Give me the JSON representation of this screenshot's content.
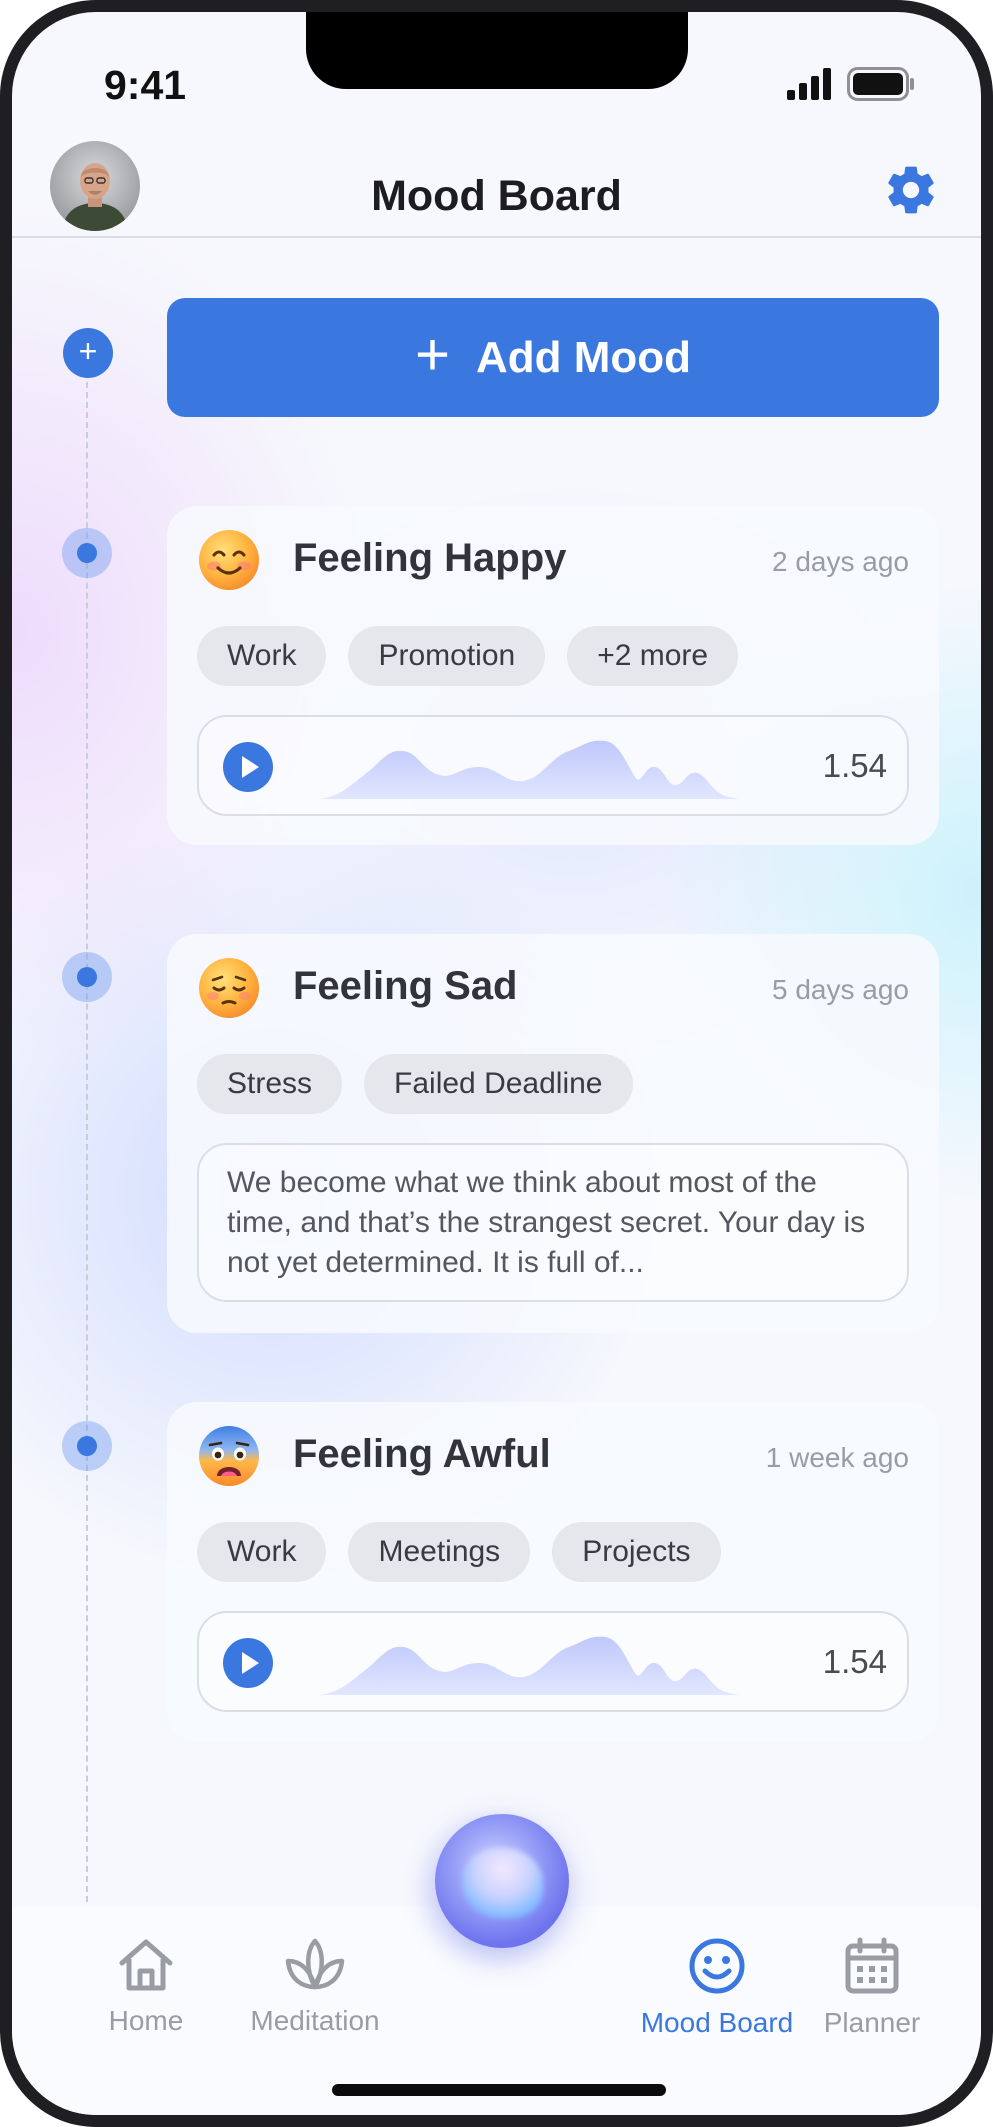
{
  "status_bar": {
    "time": "9:41"
  },
  "header": {
    "title": "Mood Board"
  },
  "add_mood": {
    "label": "Add Mood",
    "plus": "+"
  },
  "moods": [
    {
      "emoji": "smiling-face-icon",
      "title": "Feeling Happy",
      "time": "2 days ago",
      "tags": [
        "Work",
        "Promotion",
        "+2 more"
      ],
      "audio": {
        "duration": "1.54"
      }
    },
    {
      "emoji": "pensive-face-icon",
      "title": "Feeling Sad",
      "time": "5 days ago",
      "tags": [
        "Stress",
        "Failed Deadline"
      ],
      "note": "We become what we think about most of the time, and that’s the strangest secret. Your day is not yet determined. It is full of..."
    },
    {
      "emoji": "anxious-face-icon",
      "title": "Feeling Awful",
      "time": "1 week ago",
      "tags": [
        "Work",
        "Meetings",
        "Projects"
      ],
      "audio": {
        "duration": "1.54"
      }
    }
  ],
  "nav": {
    "home": "Home",
    "meditation": "Meditation",
    "mood_board": "Mood Board",
    "planner": "Planner",
    "active": "mood_board"
  },
  "colors": {
    "accent": "#3a78e0",
    "muted": "#9a9ca4"
  }
}
